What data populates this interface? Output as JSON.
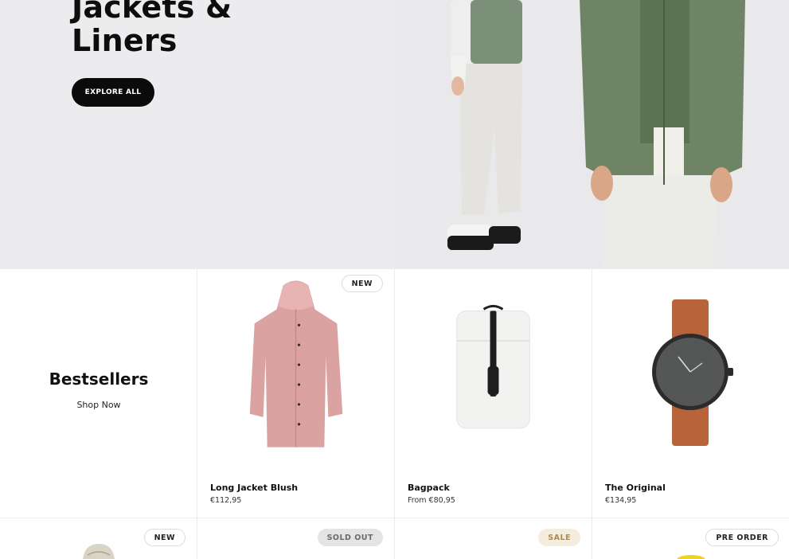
{
  "hero": {
    "title": "Jackets &\nLiners",
    "button_label": "EXPLORE ALL",
    "colors": {
      "left_bg": "#ececef",
      "right_bg": "#e9e9ec",
      "button_bg": "#0b0b0b"
    }
  },
  "bestsellers": {
    "title": "Bestsellers",
    "link": "Shop Now"
  },
  "products_row1": [
    {
      "badge": "NEW",
      "name": "Long Jacket Blush",
      "price": "€112,95",
      "icon": "pink-rain-jacket"
    },
    {
      "badge": "",
      "name": "Bagpack",
      "price": "From €80,95",
      "icon": "white-backpack"
    },
    {
      "badge": "",
      "name": "The Original",
      "price": "€134,95",
      "icon": "leather-strap-watch"
    }
  ],
  "products_row2": [
    {
      "badge": "NEW",
      "icon": "bucket-hat"
    },
    {
      "badge": "SOLD OUT"
    },
    {
      "badge": "SALE"
    },
    {
      "badge": "PRE ORDER",
      "icon": "yellow-item"
    }
  ]
}
